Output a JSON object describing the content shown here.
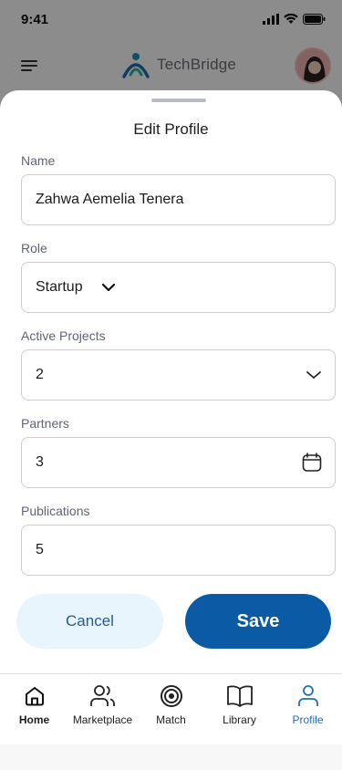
{
  "status_bar": {
    "time": "9:41"
  },
  "header": {
    "logo_text": "TechBridge"
  },
  "sheet": {
    "title": "Edit Profile",
    "fields": {
      "name": {
        "label": "Name",
        "value": "Zahwa Aemelia Tenera"
      },
      "role": {
        "label": "Role",
        "value": "Startup"
      },
      "active_projects": {
        "label": "Active Projects",
        "value": "2"
      },
      "partners": {
        "label": "Partners",
        "value": "3"
      },
      "publications": {
        "label": "Publications",
        "value": "5"
      }
    },
    "cancel_label": "Cancel",
    "save_label": "Save"
  },
  "nav": {
    "items": [
      {
        "label": "Home",
        "icon": "home-icon"
      },
      {
        "label": "Marketplace",
        "icon": "users-icon"
      },
      {
        "label": "Match",
        "icon": "target-icon"
      },
      {
        "label": "Library",
        "icon": "book-icon"
      },
      {
        "label": "Profile",
        "icon": "user-icon"
      }
    ],
    "active": "Profile"
  },
  "colors": {
    "primary": "#0b5aa6",
    "cancel_bg": "#e8f5fd",
    "active_nav": "#1f6fb5",
    "overlay": "rgba(0,0,0,0.45)"
  }
}
